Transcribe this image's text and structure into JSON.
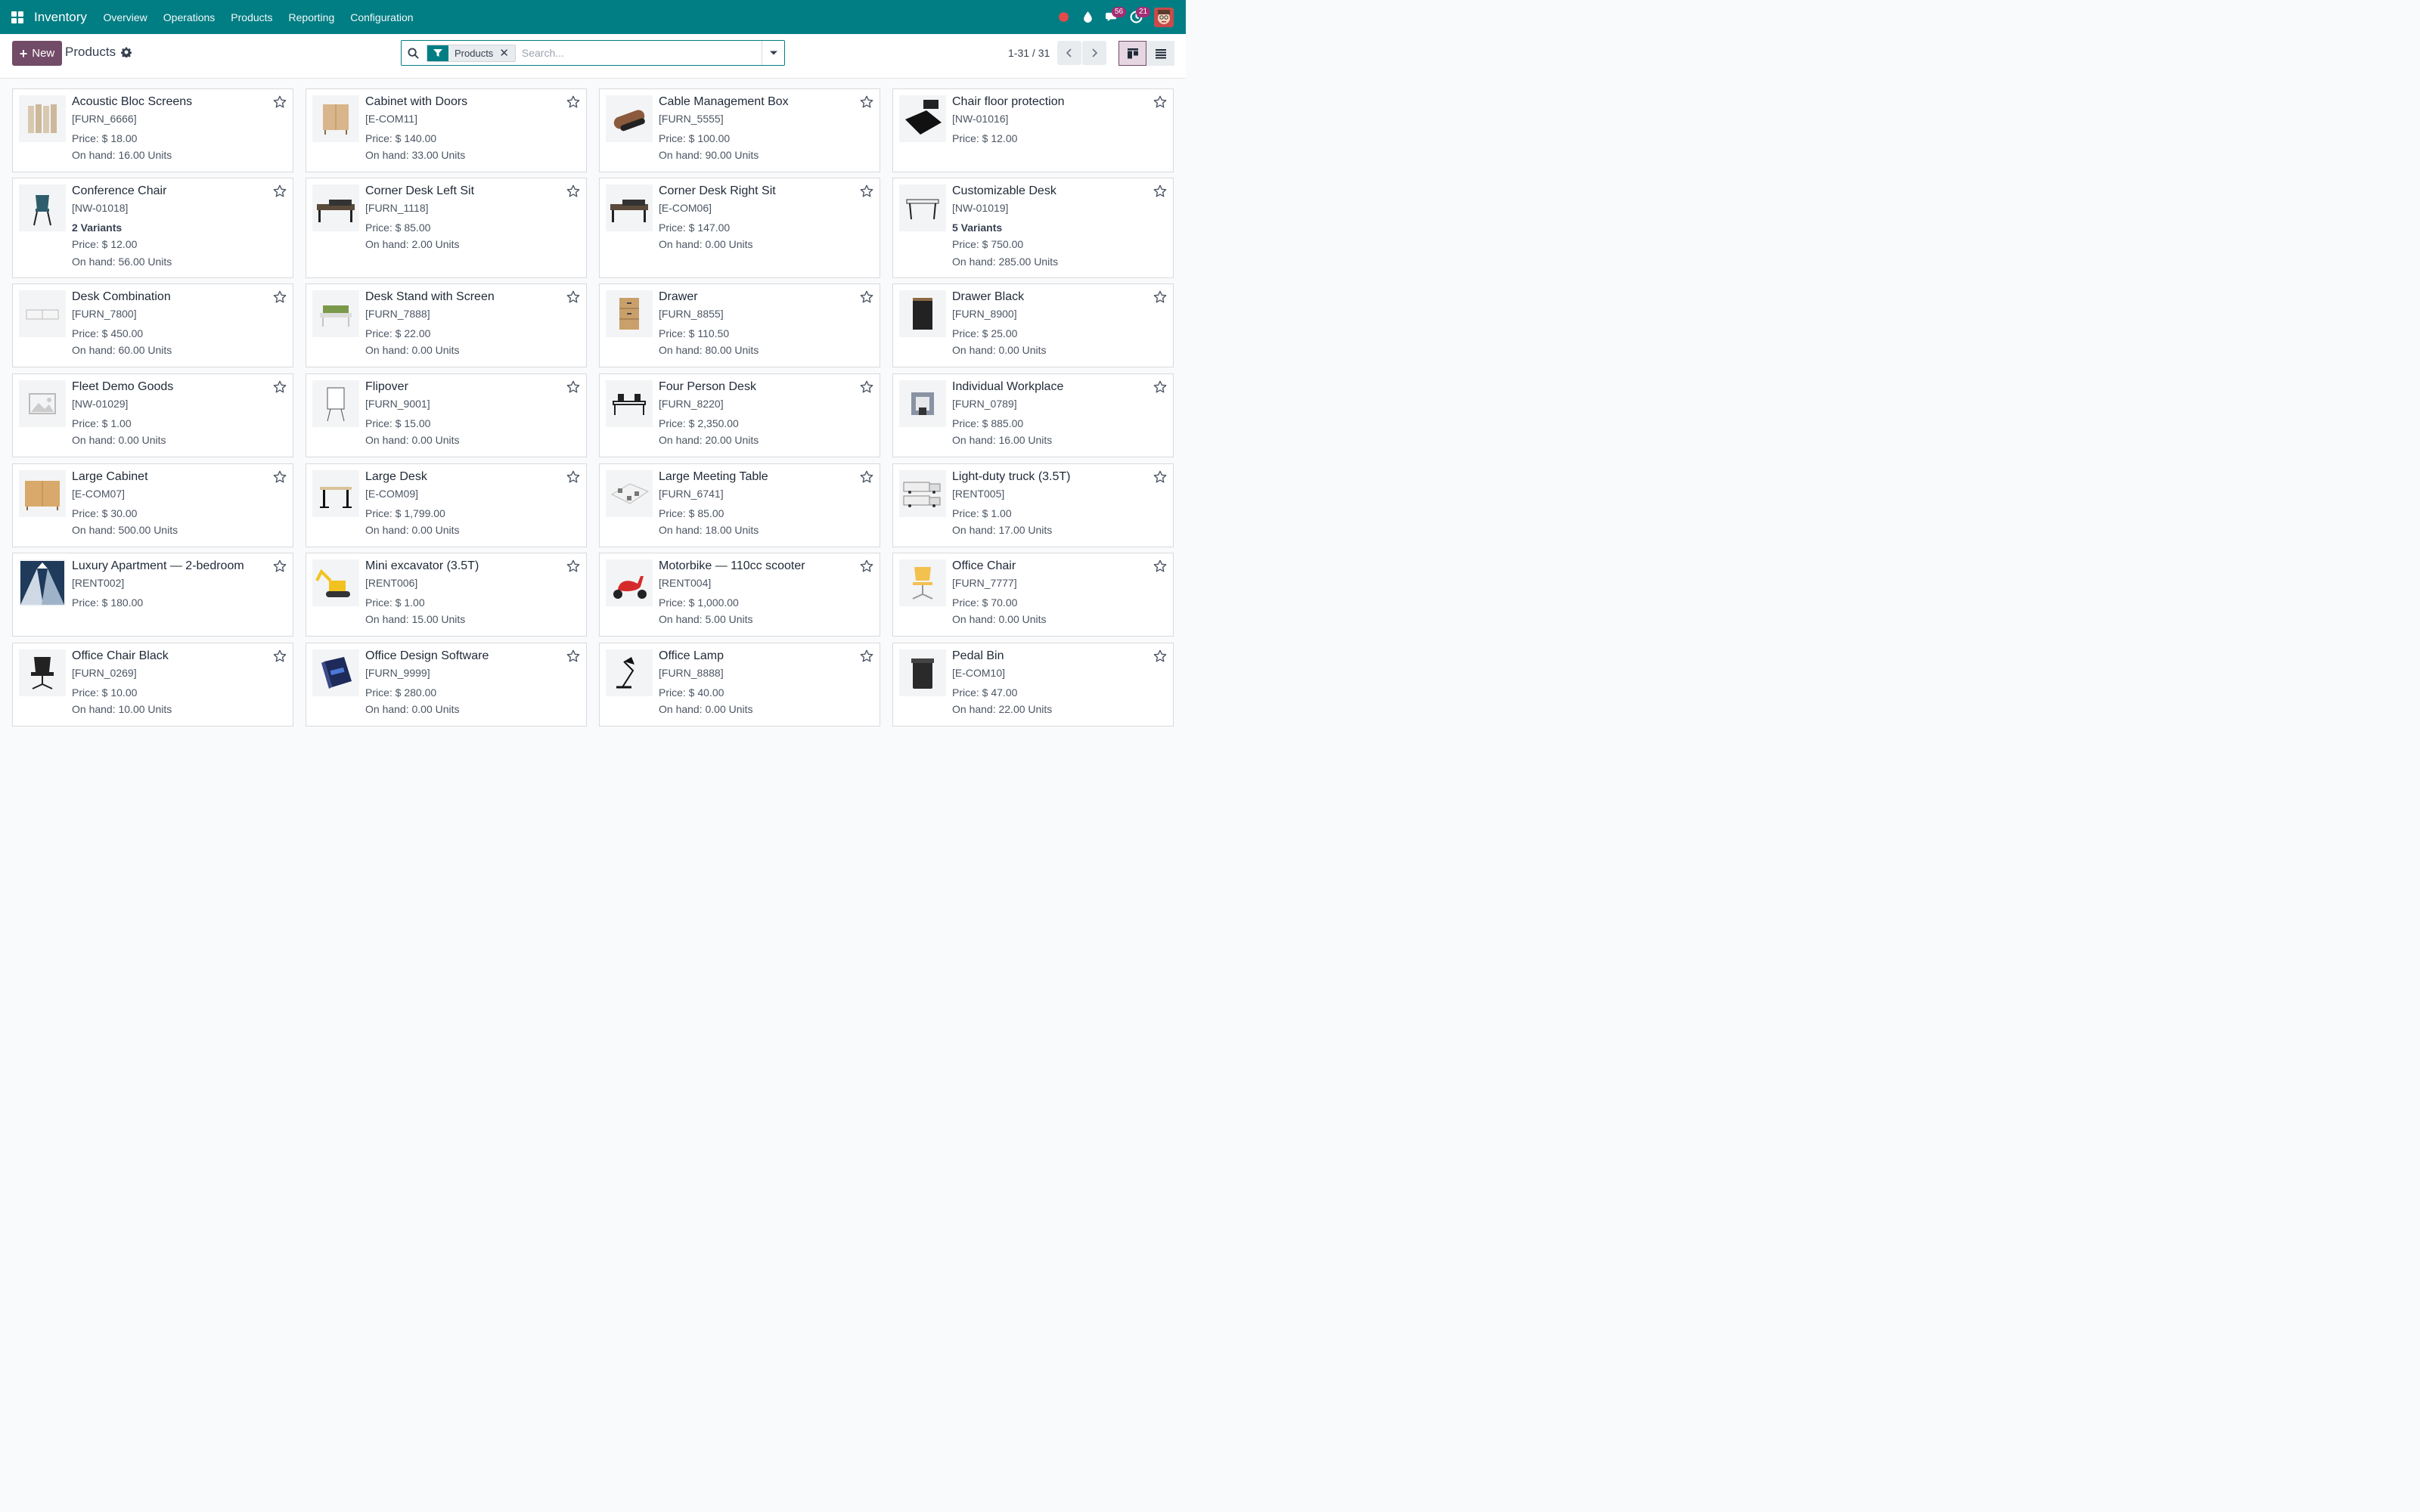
{
  "navbar": {
    "app_name": "Inventory",
    "menu": [
      "Overview",
      "Operations",
      "Products",
      "Reporting",
      "Configuration"
    ],
    "messages_count": "56",
    "activities_count": "21",
    "color": "#017e84"
  },
  "control": {
    "new_label": "New",
    "breadcrumb": "Products",
    "search": {
      "facet": "Products",
      "placeholder": "Search..."
    },
    "pager": "1-31 / 31"
  },
  "products": [
    {
      "name": "Acoustic Bloc Screens",
      "ref": "[FURN_6666]",
      "variants": "",
      "price": "Price: $ 18.00",
      "onhand": "On hand: 16.00 Units",
      "icon": "screen-icon"
    },
    {
      "name": "Cabinet with Doors",
      "ref": "[E-COM11]",
      "variants": "",
      "price": "Price: $ 140.00",
      "onhand": "On hand: 33.00 Units",
      "icon": "cabinet-icon"
    },
    {
      "name": "Cable Management Box",
      "ref": "[FURN_5555]",
      "variants": "",
      "price": "Price: $ 100.00",
      "onhand": "On hand: 90.00 Units",
      "icon": "box-icon"
    },
    {
      "name": "Chair floor protection",
      "ref": "[NW-01016]",
      "variants": "",
      "price": "Price: $ 12.00",
      "onhand": "",
      "icon": "floor-mat-icon"
    },
    {
      "name": "Conference Chair",
      "ref": "[NW-01018]",
      "variants": "2 Variants",
      "price": "Price: $ 12.00",
      "onhand": "On hand: 56.00 Units",
      "icon": "chair-icon"
    },
    {
      "name": "Corner Desk Left Sit",
      "ref": "[FURN_1118]",
      "variants": "",
      "price": "Price: $ 85.00",
      "onhand": "On hand: 2.00 Units",
      "icon": "desk-icon"
    },
    {
      "name": "Corner Desk Right Sit",
      "ref": "[E-COM06]",
      "variants": "",
      "price": "Price: $ 147.00",
      "onhand": "On hand: 0.00 Units",
      "icon": "desk-icon"
    },
    {
      "name": "Customizable Desk",
      "ref": "[NW-01019]",
      "variants": "5 Variants",
      "price": "Price: $ 750.00",
      "onhand": "On hand: 285.00 Units",
      "icon": "table-icon"
    },
    {
      "name": "Desk Combination",
      "ref": "[FURN_7800]",
      "variants": "",
      "price": "Price: $ 450.00",
      "onhand": "On hand: 60.00 Units",
      "icon": "desk-combo-icon"
    },
    {
      "name": "Desk Stand with Screen",
      "ref": "[FURN_7888]",
      "variants": "",
      "price": "Price: $ 22.00",
      "onhand": "On hand: 0.00 Units",
      "icon": "desk-screen-icon"
    },
    {
      "name": "Drawer",
      "ref": "[FURN_8855]",
      "variants": "",
      "price": "Price: $ 110.50",
      "onhand": "On hand: 80.00 Units",
      "icon": "drawer-icon"
    },
    {
      "name": "Drawer Black",
      "ref": "[FURN_8900]",
      "variants": "",
      "price": "Price: $ 25.00",
      "onhand": "On hand: 0.00 Units",
      "icon": "drawer-black-icon"
    },
    {
      "name": "Fleet Demo Goods",
      "ref": "[NW-01029]",
      "variants": "",
      "price": "Price: $ 1.00",
      "onhand": "On hand: 0.00 Units",
      "icon": "image-placeholder-icon"
    },
    {
      "name": "Flipover",
      "ref": "[FURN_9001]",
      "variants": "",
      "price": "Price: $ 15.00",
      "onhand": "On hand: 0.00 Units",
      "icon": "flipchart-icon"
    },
    {
      "name": "Four Person Desk",
      "ref": "[FURN_8220]",
      "variants": "",
      "price": "Price: $ 2,350.00",
      "onhand": "On hand: 20.00 Units",
      "icon": "four-desk-icon"
    },
    {
      "name": "Individual Workplace",
      "ref": "[FURN_0789]",
      "variants": "",
      "price": "Price: $ 885.00",
      "onhand": "On hand: 16.00 Units",
      "icon": "workplace-icon"
    },
    {
      "name": "Large Cabinet",
      "ref": "[E-COM07]",
      "variants": "",
      "price": "Price: $ 30.00",
      "onhand": "On hand: 500.00 Units",
      "icon": "large-cabinet-icon"
    },
    {
      "name": "Large Desk",
      "ref": "[E-COM09]",
      "variants": "",
      "price": "Price: $ 1,799.00",
      "onhand": "On hand: 0.00 Units",
      "icon": "large-desk-icon"
    },
    {
      "name": "Large Meeting Table",
      "ref": "[FURN_6741]",
      "variants": "",
      "price": "Price: $ 85.00",
      "onhand": "On hand: 18.00 Units",
      "icon": "meeting-table-icon"
    },
    {
      "name": "Light-duty truck (3.5T)",
      "ref": "[RENT005]",
      "variants": "",
      "price": "Price: $ 1.00",
      "onhand": "On hand: 17.00 Units",
      "icon": "truck-icon"
    },
    {
      "name": "Luxury Apartment — 2-bedroom",
      "ref": "[RENT002]",
      "variants": "",
      "price": "Price: $ 180.00",
      "onhand": "",
      "icon": "building-icon"
    },
    {
      "name": "Mini excavator (3.5T)",
      "ref": "[RENT006]",
      "variants": "",
      "price": "Price: $ 1.00",
      "onhand": "On hand: 15.00 Units",
      "icon": "excavator-icon"
    },
    {
      "name": "Motorbike — 110cc scooter",
      "ref": "[RENT004]",
      "variants": "",
      "price": "Price: $ 1,000.00",
      "onhand": "On hand: 5.00 Units",
      "icon": "scooter-icon"
    },
    {
      "name": "Office Chair",
      "ref": "[FURN_7777]",
      "variants": "",
      "price": "Price: $ 70.00",
      "onhand": "On hand: 0.00 Units",
      "icon": "office-chair-icon"
    },
    {
      "name": "Office Chair Black",
      "ref": "[FURN_0269]",
      "variants": "",
      "price": "Price: $ 10.00",
      "onhand": "On hand: 10.00 Units",
      "icon": "office-chair-black-icon"
    },
    {
      "name": "Office Design Software",
      "ref": "[FURN_9999]",
      "variants": "",
      "price": "Price: $ 280.00",
      "onhand": "On hand: 0.00 Units",
      "icon": "software-box-icon"
    },
    {
      "name": "Office Lamp",
      "ref": "[FURN_8888]",
      "variants": "",
      "price": "Price: $ 40.00",
      "onhand": "On hand: 0.00 Units",
      "icon": "lamp-icon"
    },
    {
      "name": "Pedal Bin",
      "ref": "[E-COM10]",
      "variants": "",
      "price": "Price: $ 47.00",
      "onhand": "On hand: 22.00 Units",
      "icon": "bin-icon"
    }
  ]
}
